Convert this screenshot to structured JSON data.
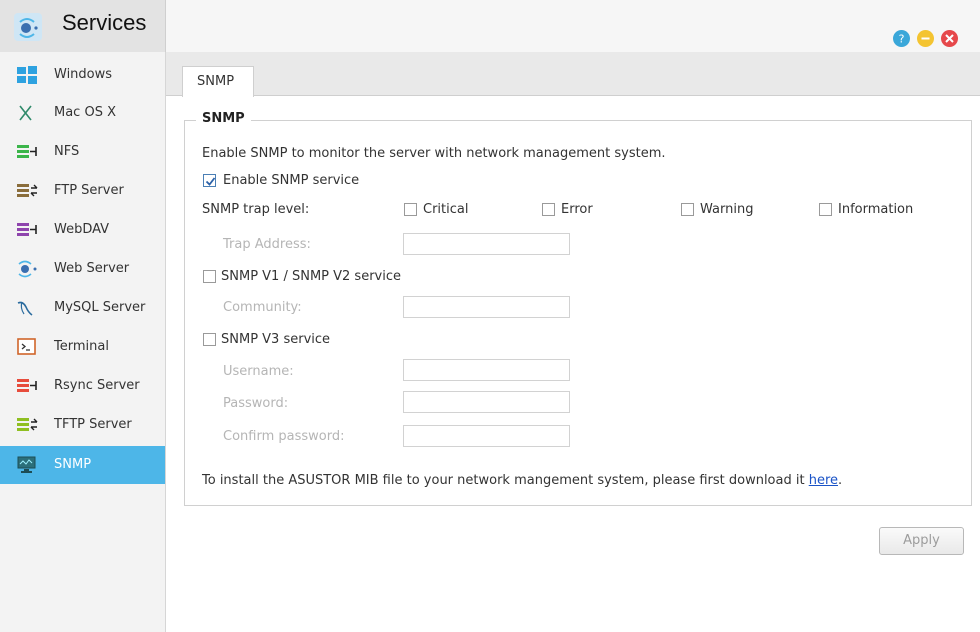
{
  "window": {
    "title": "Services",
    "controls": [
      "help-icon",
      "minimize-icon",
      "close-icon"
    ]
  },
  "sidebar": {
    "items": [
      {
        "label": "Windows",
        "icon": "windows-icon"
      },
      {
        "label": "Mac OS X",
        "icon": "mac-os-x-icon"
      },
      {
        "label": "NFS",
        "icon": "nfs-icon"
      },
      {
        "label": "FTP Server",
        "icon": "ftp-server-icon"
      },
      {
        "label": "WebDAV",
        "icon": "webdav-icon"
      },
      {
        "label": "Web Server",
        "icon": "web-server-icon"
      },
      {
        "label": "MySQL Server",
        "icon": "mysql-server-icon"
      },
      {
        "label": "Terminal",
        "icon": "terminal-icon"
      },
      {
        "label": "Rsync Server",
        "icon": "rsync-server-icon"
      },
      {
        "label": "TFTP Server",
        "icon": "tftp-server-icon"
      },
      {
        "label": "SNMP",
        "icon": "snmp-icon",
        "active": true
      }
    ]
  },
  "tabs": [
    {
      "label": "SNMP"
    }
  ],
  "snmp": {
    "legend": "SNMP",
    "description": "Enable SNMP to monitor the server with network management system.",
    "enable_label": "Enable SNMP service",
    "enable_checked": true,
    "trap_level_label": "SNMP trap level:",
    "trap_levels": [
      {
        "label": "Critical",
        "checked": false
      },
      {
        "label": "Error",
        "checked": false
      },
      {
        "label": "Warning",
        "checked": false
      },
      {
        "label": "Information",
        "checked": false
      }
    ],
    "trap_address_label": "Trap Address:",
    "trap_address_value": "",
    "v1v2_label": "SNMP V1 / SNMP V2 service",
    "v1v2_checked": false,
    "community_label": "Community:",
    "community_value": "",
    "v3_label": "SNMP V3 service",
    "v3_checked": false,
    "username_label": "Username:",
    "username_value": "",
    "password_label": "Password:",
    "password_value": "",
    "confirm_password_label": "Confirm password:",
    "confirm_password_value": "",
    "mib_text": "To install the ASUSTOR MIB file to your network mangement system, please first download it ",
    "mib_link": "here",
    "mib_suffix": "."
  },
  "apply_label": "Apply",
  "colors": {
    "accent": "#4db6e8",
    "link": "#1a53c7",
    "help": "#3aa7d9",
    "minimize": "#f4c431",
    "close": "#e6484b"
  }
}
